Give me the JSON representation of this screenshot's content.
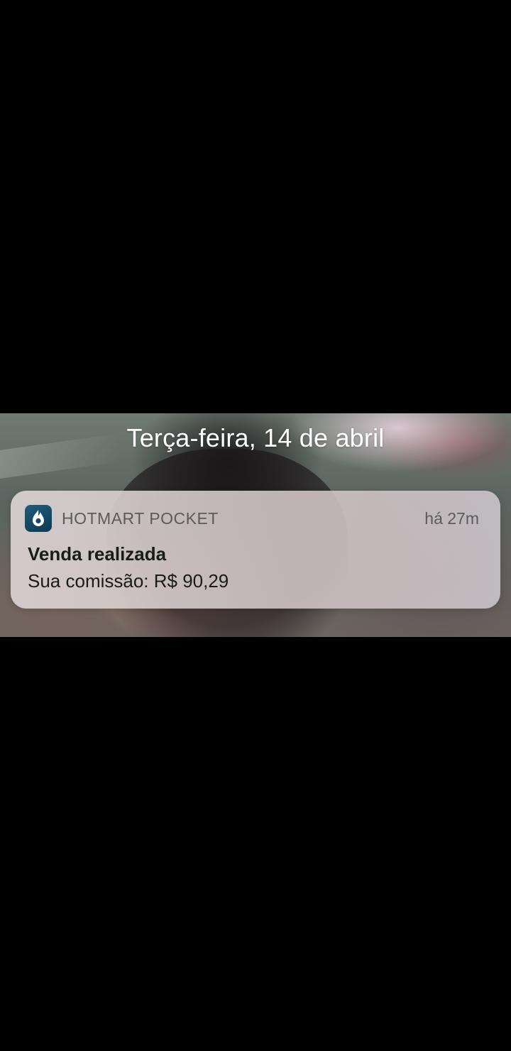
{
  "lockscreen": {
    "date": "Terça-feira, 14 de abril"
  },
  "notification": {
    "app_icon": "hotmart-flame-icon",
    "app_icon_color": "#1f5c7a",
    "app_name": "HOTMART POCKET",
    "time_ago": "há 27m",
    "title": "Venda realizada",
    "body": "Sua comissão: R$ 90,29"
  }
}
